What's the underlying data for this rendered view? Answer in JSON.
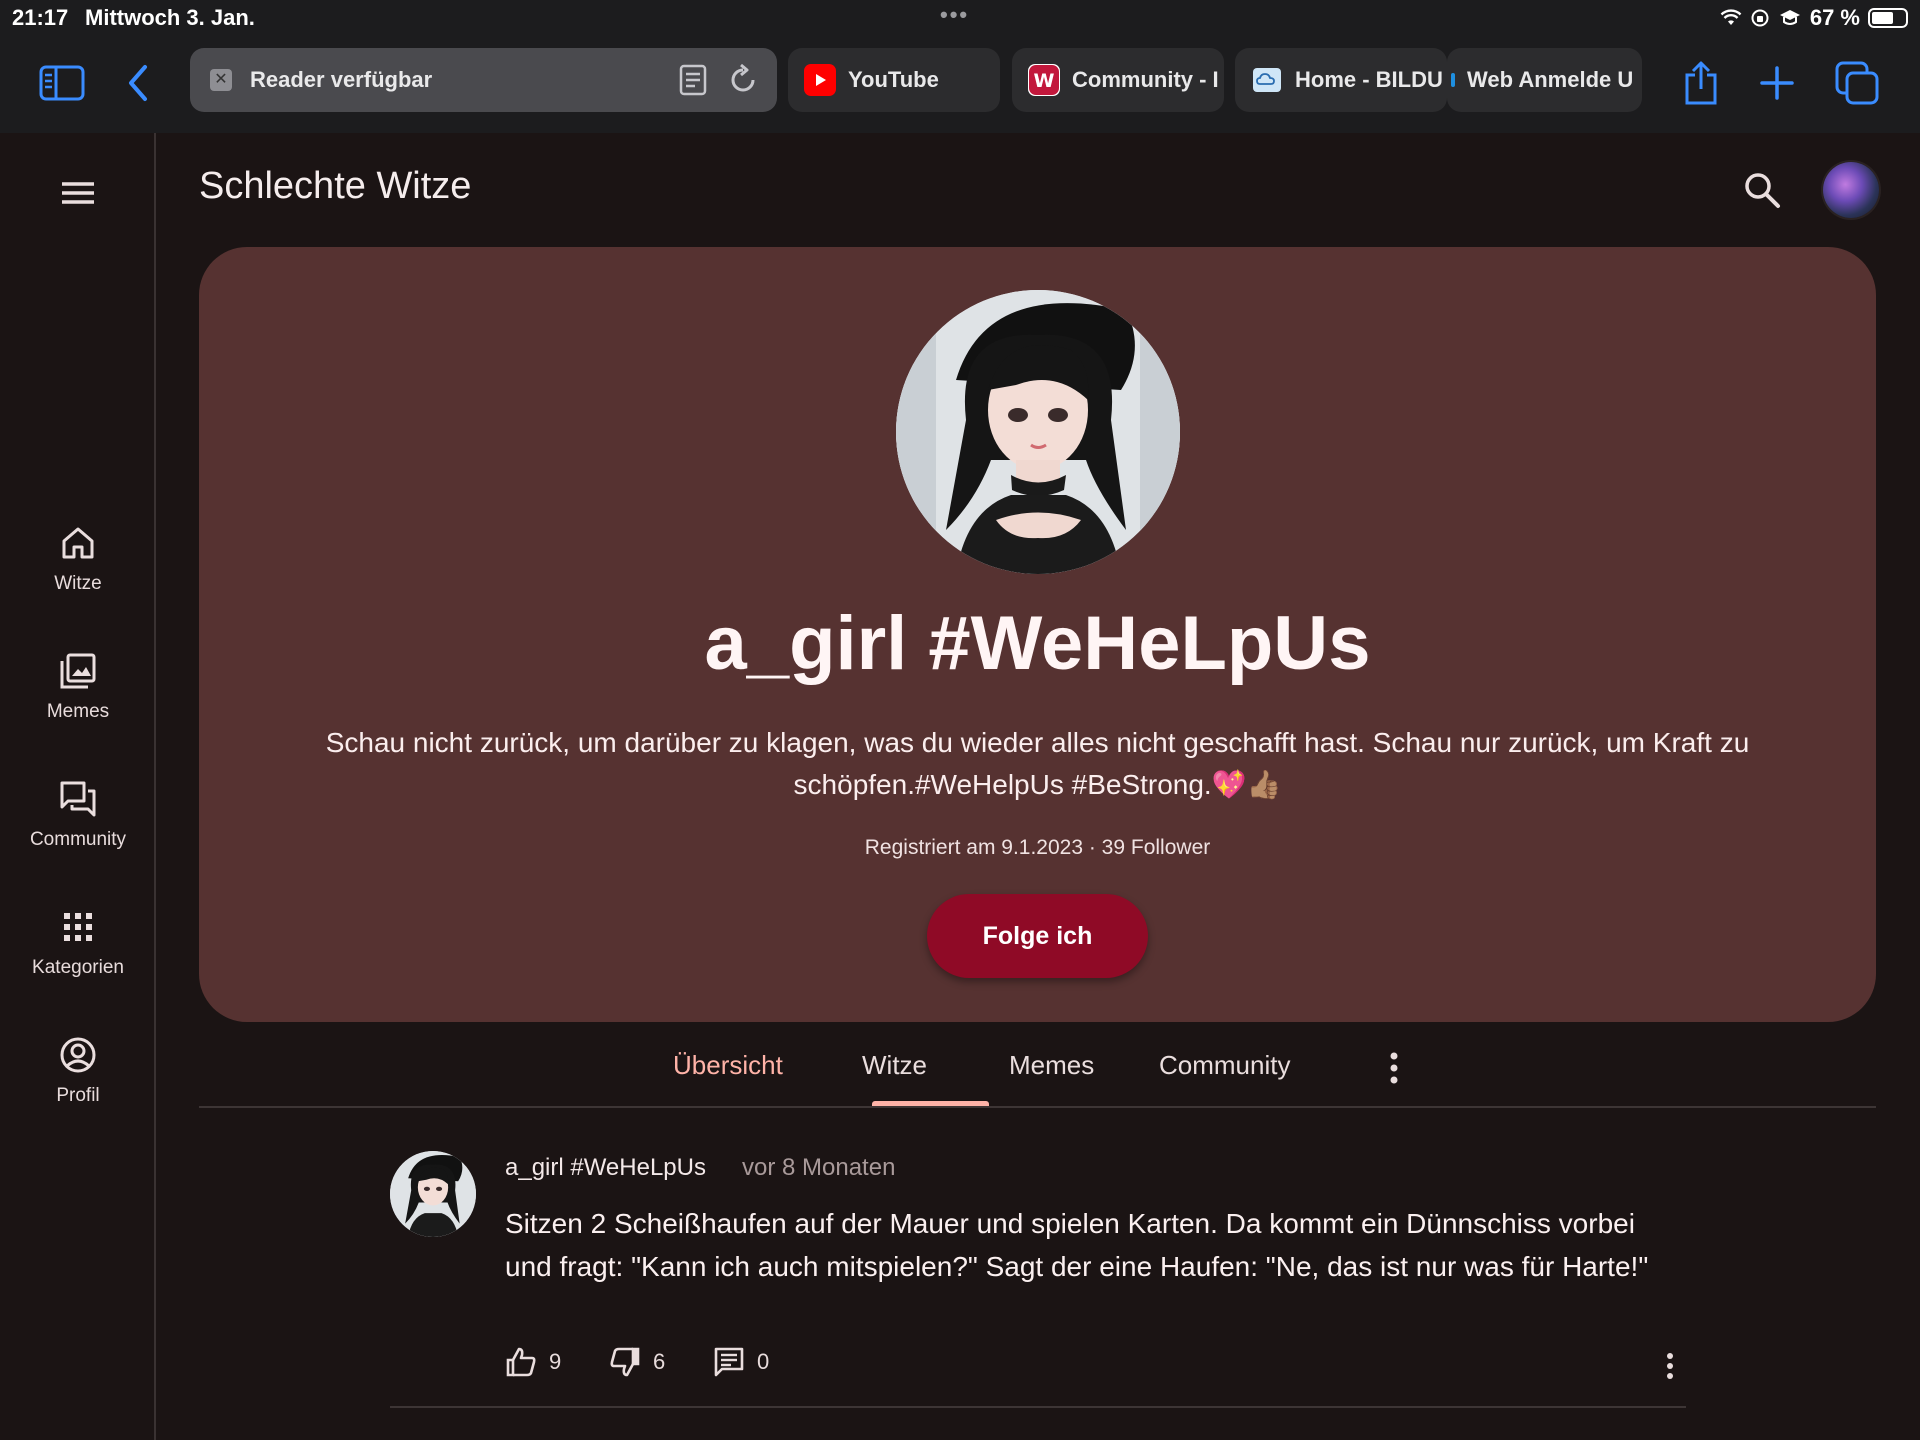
{
  "status_bar": {
    "time": "21:17",
    "date": "Mittwoch 3. Jan.",
    "dots": "•••",
    "battery": "67 %",
    "battery_level": 0.67
  },
  "browser": {
    "address_label": "Reader verfügbar",
    "tabs": [
      {
        "title": "YouTube",
        "icon": "youtube-icon"
      },
      {
        "title": "Community - I",
        "icon": "w-logo-icon"
      },
      {
        "title": "Home - BILDU",
        "icon": "cloud-icon"
      },
      {
        "title": "Web Anmelde U",
        "icon": "web-icon"
      }
    ]
  },
  "sidebar": {
    "items": [
      {
        "label": "Witze",
        "icon": "home-icon"
      },
      {
        "label": "Memes",
        "icon": "image-icon"
      },
      {
        "label": "Community",
        "icon": "forum-icon"
      },
      {
        "label": "Kategorien",
        "icon": "grid-icon"
      },
      {
        "label": "Profil",
        "icon": "account-icon"
      }
    ]
  },
  "header": {
    "title": "Schlechte Witze"
  },
  "profile": {
    "name": "a_girl #WeHeLpUs",
    "bio_line1": "Schau nicht zurück, um darüber zu klagen, was du wieder alles nicht geschafft hast. Schau nur zurück, um Kraft zu",
    "bio_line2": "schöpfen.#WeHelpUs #BeStrong.💖👍🏽",
    "meta": "Registriert am 9.1.2023 · 39 Follower",
    "follow_label": "Folge ich"
  },
  "profile_tabs": {
    "items": [
      "Übersicht",
      "Witze",
      "Memes",
      "Community"
    ],
    "active": "Übersicht"
  },
  "post": {
    "author": "a_girl #WeHeLpUs",
    "time": "vor 8 Monaten",
    "text": "Sitzen 2 Scheißhaufen auf der Mauer und spielen Karten. Da kommt ein Dünnschiss vorbei und fragt: \"Kann ich auch mitspielen?\" Sagt der eine Haufen: \"Ne, das ist nur was für Harte!\"",
    "likes": "9",
    "dislikes": "6",
    "comments": "0"
  },
  "colors": {
    "background": "#1b1414",
    "card": "#563231",
    "accent_button": "#8f0a26",
    "active_tab": "#ffb3a8",
    "browser_blue": "#3a8cff"
  }
}
